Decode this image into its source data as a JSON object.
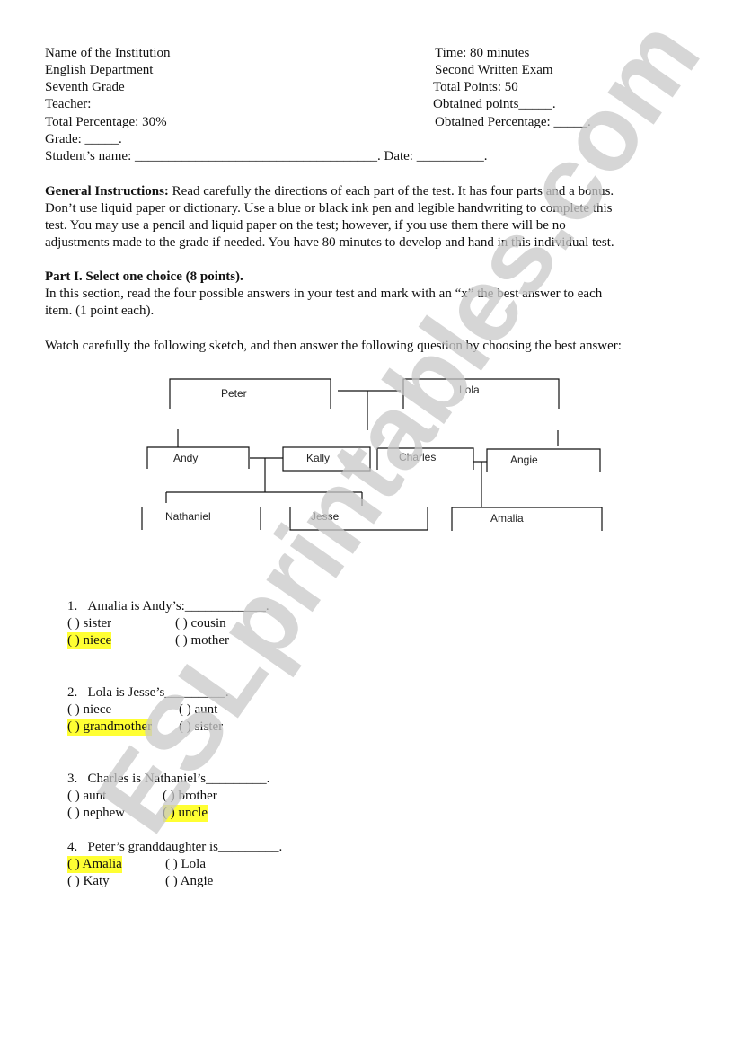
{
  "header": {
    "left": [
      "Name of the Institution",
      "English Department",
      "Seventh Grade",
      "Teacher:",
      "Total Percentage: 30%",
      "Grade: _____."
    ],
    "right": [
      "Time: 80 minutes",
      "Second Written Exam",
      " Total Points: 50",
      " Obtained points_____.",
      "Obtained  Percentage: _____."
    ],
    "student_line": " Student’s name: ____________________________________. Date: __________."
  },
  "instructions": {
    "label": "General Instructions:",
    "lines": [
      " Read carefully the directions of each part of the test. It has four parts and a bonus.",
      "Don’t use liquid paper or dictionary. Use a blue or black ink pen and legible handwriting to complete this",
      "test. You may use a pencil and liquid paper on the test; however, if you use them there will be no",
      "adjustments made to the grade if needed. You have 80 minutes to develop and hand in this individual test."
    ]
  },
  "part1": {
    "title": "Part I. Select one choice (8 points).",
    "lines": [
      "In this section, read the four possible answers in your test and mark with an “x” the best answer to each",
      "item. (1 point each)."
    ],
    "prompt": "Watch carefully the following sketch, and then answer the following question by choosing the best answer:"
  },
  "family_tree": {
    "members": [
      "Peter",
      "Lola",
      "Andy",
      "Kally",
      "Charles",
      "Angie",
      "Nathaniel",
      "Jesse",
      "Amalia"
    ]
  },
  "questions": [
    {
      "number": "1.",
      "text": "Amalia is Andy’s:____________.",
      "options": [
        "( ) sister",
        "(  ) cousin",
        "( ) niece",
        "(  ) mother"
      ],
      "highlighted": 2
    },
    {
      "number": "2.",
      "text": "Lola is Jesse’s_________.",
      "options": [
        "(  ) niece",
        "(  ) aunt",
        "(  ) grandmother",
        "(  ) sister"
      ],
      "highlighted": 2
    },
    {
      "number": "3.",
      "text": "Charles is Nathaniel’s_________.",
      "options": [
        "(  ) aunt",
        "(  ) brother",
        "(  ) nephew",
        "(  ) uncle"
      ],
      "highlighted": 3
    },
    {
      "number": "4.",
      "text": "Peter’s granddaughter is_________.",
      "options": [
        "(  ) Amalia",
        "(  ) Lola",
        "(  ) Katy",
        "(  ) Angie"
      ],
      "highlighted": 0
    }
  ],
  "watermark": "ESLprintables.com",
  "colors": {
    "highlight": "#ffff33",
    "watermark": "#c8c8c8"
  }
}
